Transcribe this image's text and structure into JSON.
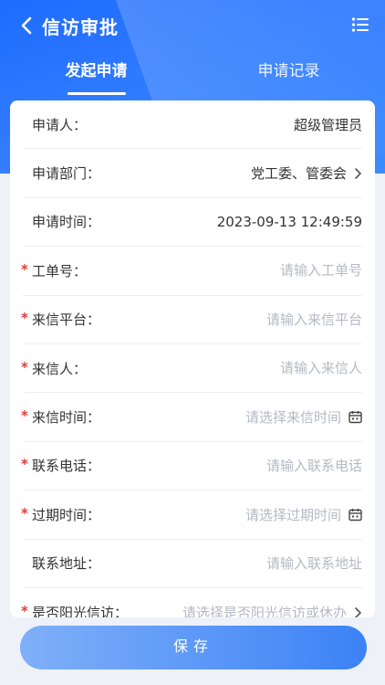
{
  "header": {
    "title": "信访审批",
    "back_icon": "chevron-left-icon",
    "menu_icon": "list-menu-icon"
  },
  "tabs": [
    {
      "label": "发起申请",
      "active": true
    },
    {
      "label": "申请记录",
      "active": false
    }
  ],
  "form": {
    "applicant": {
      "label": "申请人：",
      "value": "超级管理员"
    },
    "department": {
      "label": "申请部门：",
      "value": "党工委、管委会"
    },
    "apply_time": {
      "label": "申请时间：",
      "value": "2023-09-13 12:49:59"
    },
    "ticket_no": {
      "label": "工单号：",
      "placeholder": "请输入工单号",
      "required": true
    },
    "platform": {
      "label": "来信平台：",
      "placeholder": "请输入来信平台",
      "required": true
    },
    "sender": {
      "label": "来信人：",
      "placeholder": "请输入来信人",
      "required": true
    },
    "letter_time": {
      "label": "来信时间：",
      "placeholder": "请选择来信时间",
      "required": true
    },
    "phone": {
      "label": "联系电话：",
      "placeholder": "请输入联系电话",
      "required": true
    },
    "expire_time": {
      "label": "过期时间：",
      "placeholder": "请选择过期时间",
      "required": true
    },
    "address": {
      "label": "联系地址：",
      "placeholder": "请输入联系地址",
      "required": false
    },
    "sunshine": {
      "label": "是否阳光信访：",
      "placeholder": "请选择是否阳光信访或休办",
      "required": true
    }
  },
  "footer": {
    "save_label": "保存"
  },
  "colors": {
    "primary": "#2f7bff",
    "required": "#e23b3b",
    "placeholder": "#b5b9c2"
  }
}
